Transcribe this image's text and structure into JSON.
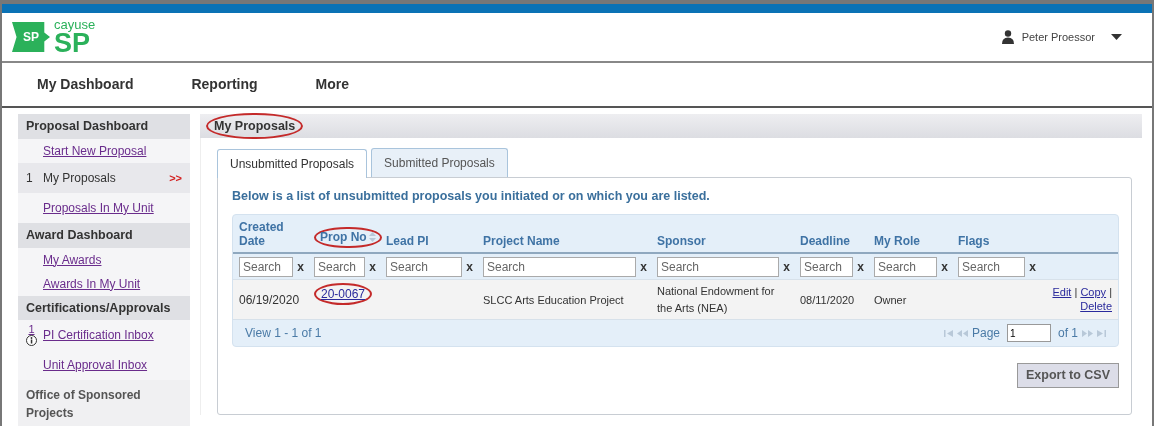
{
  "header": {
    "logo_badge": "SP",
    "logo_small": "cayuse",
    "logo_large": "SP",
    "user": "Peter Proessor"
  },
  "nav": [
    {
      "label": "My Dashboard"
    },
    {
      "label": "Reporting"
    },
    {
      "label": "More"
    }
  ],
  "sidebar": [
    {
      "title": "Proposal Dashboard",
      "items": [
        {
          "kind": "link",
          "label": "Start New Proposal",
          "selected": false
        },
        {
          "kind": "current",
          "count": "1",
          "label": "My Proposals",
          "marker": ">>",
          "selected": true
        },
        {
          "kind": "link",
          "label": "Proposals In My Unit",
          "selected": false
        }
      ]
    },
    {
      "title": "Award Dashboard",
      "items": [
        {
          "kind": "link",
          "label": "My Awards",
          "selected": false
        },
        {
          "kind": "link",
          "label": "Awards In My Unit",
          "selected": false
        }
      ]
    },
    {
      "title": "Certifications/Approvals",
      "items": [
        {
          "kind": "info",
          "count": "1",
          "label": "PI Certification Inbox",
          "selected": false
        },
        {
          "kind": "link",
          "label": "Unit Approval Inbox",
          "selected": false
        }
      ]
    },
    {
      "title": "Office of Sponsored Projects"
    }
  ],
  "panel": {
    "title": "My Proposals",
    "circled": true
  },
  "tabs": [
    {
      "label": "Unsubmitted Proposals",
      "selected": true
    },
    {
      "label": "Submitted Proposals",
      "selected": false
    }
  ],
  "description": "Below is a list of unsubmitted proposals you initiated or on which you are listed.",
  "table": {
    "columns": [
      {
        "label": "Created Date",
        "sortable": false,
        "circled": false
      },
      {
        "label": "Prop No",
        "sortable": true,
        "circled": true
      },
      {
        "label": "Lead PI",
        "sortable": false,
        "circled": false
      },
      {
        "label": "Project Name",
        "sortable": false,
        "circled": false
      },
      {
        "label": "Sponsor",
        "sortable": false,
        "circled": false
      },
      {
        "label": "Deadline",
        "sortable": false,
        "circled": false
      },
      {
        "label": "My Role",
        "sortable": false,
        "circled": false
      },
      {
        "label": "Flags",
        "sortable": false,
        "circled": false
      }
    ],
    "filters": [
      {
        "placeholder": "Search",
        "clear": "x"
      },
      {
        "placeholder": "Search",
        "clear": "x"
      },
      {
        "placeholder": "Search",
        "clear": "x"
      },
      {
        "placeholder": "Search",
        "clear": "x"
      },
      {
        "placeholder": "Search",
        "clear": "x"
      },
      {
        "placeholder": "Search",
        "clear": "x"
      },
      {
        "placeholder": "Search",
        "clear": "x"
      },
      {
        "placeholder": "Search",
        "clear": "x"
      }
    ],
    "rows": [
      {
        "created_date": "06/19/2020",
        "prop_no": "20-0067",
        "prop_no_circled": true,
        "project_name": "SLCC Arts Education Project",
        "sponsor": "National Endowment for the Arts (NEA)",
        "deadline": "08/11/2020",
        "my_role": "Owner",
        "actions": [
          "Edit",
          "Copy",
          "Delete"
        ],
        "action_separators": [
          "|",
          "|"
        ]
      }
    ],
    "pager": {
      "view": "View 1 - 1 of 1",
      "page_label": "Page",
      "page": "1",
      "of": "of 1"
    }
  },
  "export_button": "Export to CSV"
}
